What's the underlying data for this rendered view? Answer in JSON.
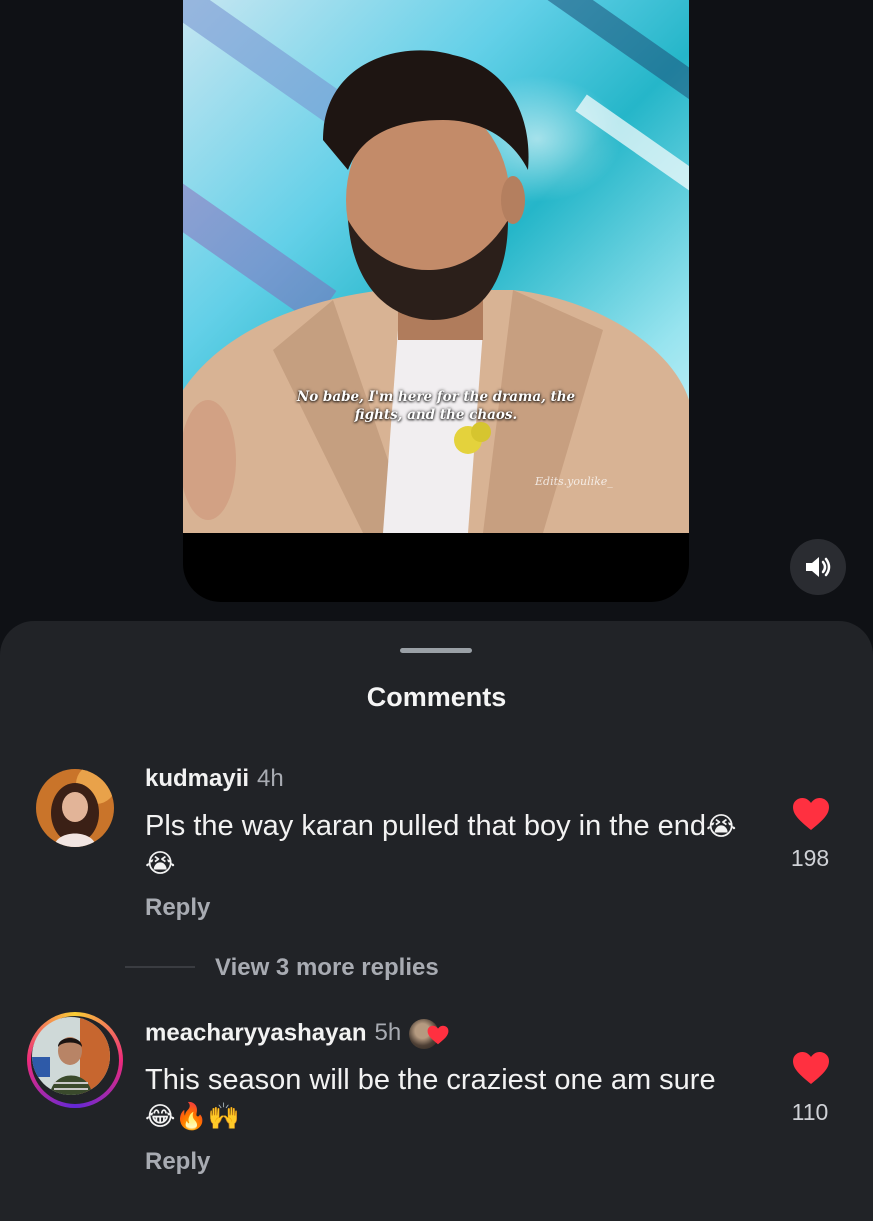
{
  "video": {
    "caption_line1": "No babe, I'm here for the drama, the",
    "caption_line2": "fights, and the chaos.",
    "watermark": "Edits.youlike_",
    "mute_icon": "volume-icon"
  },
  "comments_sheet": {
    "title": "Comments",
    "comments": [
      {
        "username": "kudmayii",
        "time": "4h",
        "text": "Pls the way karan pulled that boy in the end",
        "emojis": "😭😭",
        "reply_label": "Reply",
        "likes": "198",
        "view_replies": "View 3 more replies"
      },
      {
        "username": "meacharyyashayan",
        "time": "5h",
        "text": "This season will be the craziest one am sure",
        "emojis": "😂🔥🙌",
        "reply_label": "Reply",
        "likes": "110"
      }
    ]
  },
  "colors": {
    "background": "#0f1115",
    "sheet": "#212327",
    "like_red": "#ff3040",
    "muted_text": "#a8abb2"
  }
}
